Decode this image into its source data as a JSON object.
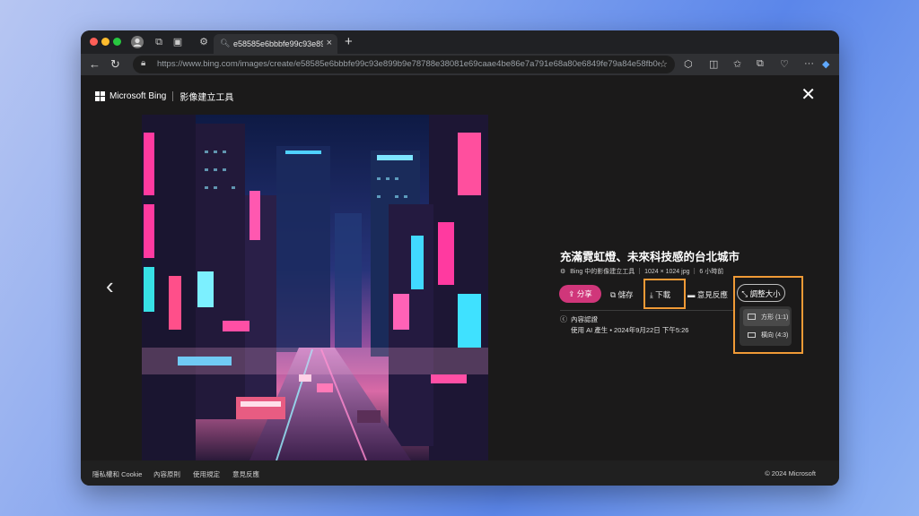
{
  "browser": {
    "tab_title": "e58585e6bbbfe99c93e899b9",
    "url": "https://www.bing.com/images/create/e58585e6bbbfe99c93e899b9e78788e38081e69caae4be86e7a791e68a80e6849fe79a84e58fb0e58c9..."
  },
  "header": {
    "brand": "Microsoft Bing",
    "product": "影像建立工具"
  },
  "info": {
    "title": "充滿霓虹燈、未來科技感的台北城市",
    "meta": "Bing 中的影像建立工具 ｜ 1024 × 1024 jpg ｜ 6 小時前",
    "share_label": "分享",
    "save_label": "儲存",
    "download_label": "下載",
    "feedback_label": "意見反應",
    "resize_label": "調整大小",
    "credential_title": "內容認證",
    "credential_detail": "使用 AI 產生 • 2024年9月22日 下午5:26"
  },
  "resize_menu": {
    "options": [
      "方形 (1:1)",
      "橫向 (4:3)"
    ]
  },
  "footer": {
    "links": [
      "隱私權和 Cookie",
      "內容原則",
      "使用規定",
      "意見反應"
    ],
    "copyright": "© 2024 Microsoft"
  },
  "colors": {
    "share_pink": "#d0367a",
    "highlight_orange": "#f09a36"
  }
}
